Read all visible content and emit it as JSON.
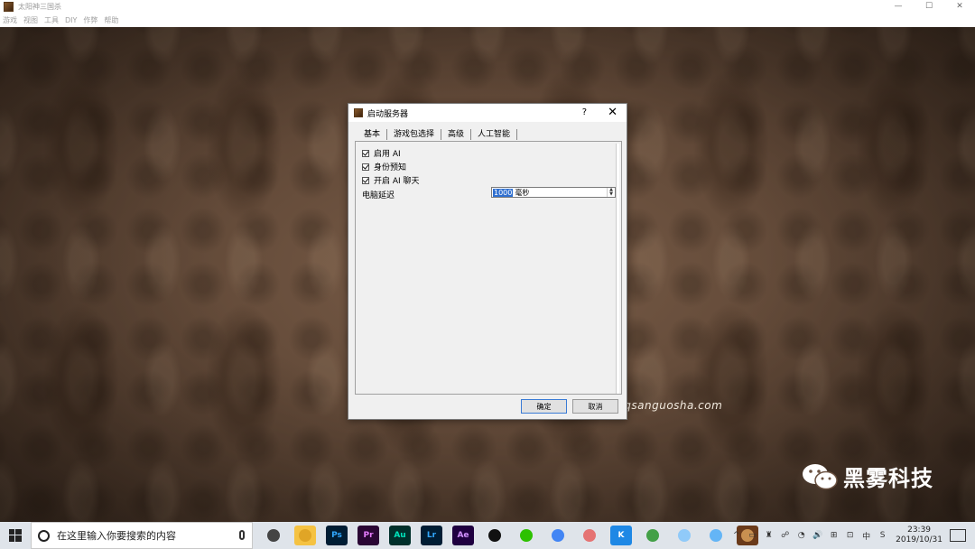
{
  "window": {
    "title": "太阳神三国杀",
    "controls": [
      "—",
      "☐",
      "✕"
    ]
  },
  "menubar": {
    "items": [
      "游戏",
      "视图",
      "工具",
      "DIY",
      "作弊",
      "帮助"
    ]
  },
  "dialog": {
    "title": "启动服务器",
    "help": "?",
    "close": "✕",
    "tabs": [
      "基本",
      "游戏包选择",
      "高级",
      "人工智能"
    ],
    "options": [
      {
        "label": "启用 AI",
        "checked": true
      },
      {
        "label": "身份预知",
        "checked": true
      },
      {
        "label": "开启 AI 聊天",
        "checked": true
      }
    ],
    "delay": {
      "label": "电脑延迟",
      "value": "1000",
      "unit": "毫秒"
    },
    "ok_label": "确定",
    "cancel_label": "取消"
  },
  "watermark": {
    "url": "http://qsanguosha.com",
    "brand": "黑雾科技"
  },
  "taskbar": {
    "search_placeholder": "在这里输入你要搜索的内容",
    "apps": [
      {
        "name": "task-view-icon",
        "label": "",
        "bg": "transparent",
        "fg": "#333"
      },
      {
        "name": "file-explorer-icon",
        "label": "",
        "bg": "#f5c242",
        "fg": "#000"
      },
      {
        "name": "photoshop-icon",
        "label": "Ps",
        "bg": "#001d34",
        "fg": "#31a8ff"
      },
      {
        "name": "premiere-icon",
        "label": "Pr",
        "bg": "#2a0634",
        "fg": "#e77cff"
      },
      {
        "name": "audition-icon",
        "label": "Au",
        "bg": "#00302b",
        "fg": "#00e4bb"
      },
      {
        "name": "lightroom-icon",
        "label": "Lr",
        "bg": "#001d34",
        "fg": "#31a8ff"
      },
      {
        "name": "after-effects-icon",
        "label": "Ae",
        "bg": "#1f0040",
        "fg": "#d291ff"
      },
      {
        "name": "qq-icon",
        "label": "",
        "bg": "transparent",
        "fg": "#000"
      },
      {
        "name": "wechat-icon",
        "label": "",
        "bg": "transparent",
        "fg": "#2dc100"
      },
      {
        "name": "chrome-icon",
        "label": "",
        "bg": "transparent",
        "fg": "#000"
      },
      {
        "name": "paint-icon",
        "label": "",
        "bg": "transparent",
        "fg": "#000"
      },
      {
        "name": "kugou-icon",
        "label": "K",
        "bg": "#1e88e5",
        "fg": "#fff"
      },
      {
        "name": "map-icon",
        "label": "",
        "bg": "transparent",
        "fg": "#000"
      },
      {
        "name": "notepad-icon",
        "label": "",
        "bg": "transparent",
        "fg": "#000"
      },
      {
        "name": "cloud-icon",
        "label": "",
        "bg": "transparent",
        "fg": "#000"
      },
      {
        "name": "sanguosha-icon",
        "label": "",
        "bg": "#6a3a1a",
        "fg": "#fff"
      }
    ],
    "tray": [
      "^",
      "▭",
      "♜",
      "☍",
      "◔",
      "🔊",
      "⊞",
      "⊡",
      "中",
      "S"
    ],
    "time": "23:39",
    "date": "2019/10/31"
  }
}
